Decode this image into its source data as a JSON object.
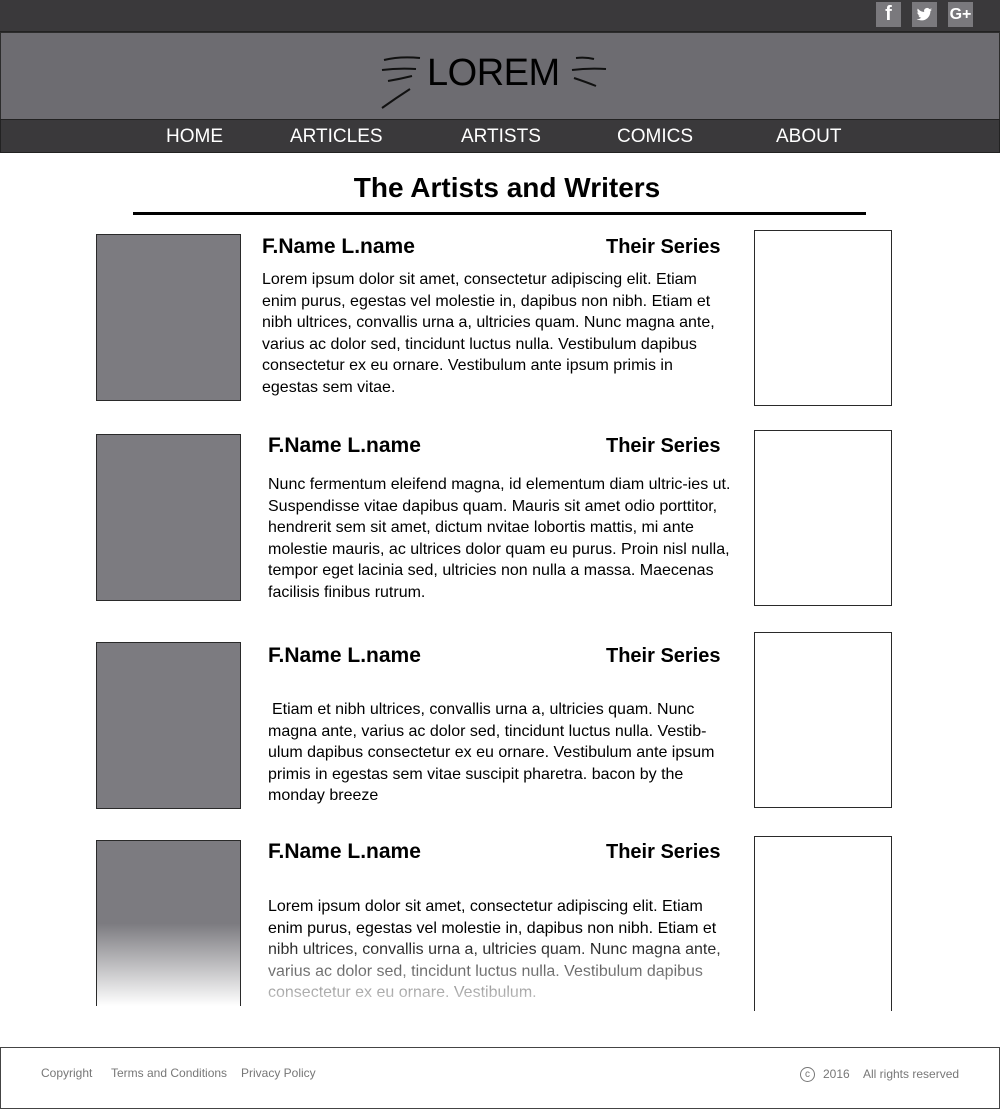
{
  "social": {
    "facebook_glyph": "f",
    "twitter_glyph": "t",
    "googleplus_glyph": "G+"
  },
  "logo": {
    "text": "LOREM"
  },
  "nav": [
    "HOME",
    "ARTICLES",
    "ARTISTS",
    "COMICS",
    "ABOUT"
  ],
  "page_title": "The Artists and Writers",
  "entries": [
    {
      "name": "F.Name L.name",
      "series": "Their Series",
      "bio": "Lorem ipsum dolor sit amet, consectetur adipiscing elit. Etiam enim purus, egestas vel molestie in, dapibus non nibh. Etiam et nibh ultrices, convallis urna a, ultricies quam. Nunc magna ante, varius ac dolor sed, tincidunt luctus nulla. Vestibulum dapibus consectetur ex eu ornare. Vestibulum ante ipsum primis in egestas sem vitae."
    },
    {
      "name": "F.Name L.name",
      "series": "Their Series",
      "bio": "Nunc fermentum eleifend magna, id elementum diam ultric-ies ut. Suspendisse vitae dapibus quam. Mauris sit amet odio porttitor, hendrerit sem sit amet, dictum nvitae lobortis mattis, mi ante molestie mauris, ac ultrices dolor quam eu purus. Proin nisl nulla, tempor eget lacinia sed, ultricies non nulla a massa. Maecenas facilisis finibus rutrum."
    },
    {
      "name": "F.Name L.name",
      "series": "Their Series",
      "bio": "Etiam et nibh ultrices, convallis urna a, ultricies quam. Nunc magna ante, varius ac dolor sed, tincidunt luctus nulla. Vestib-ulum dapibus consectetur ex eu ornare. Vestibulum ante ipsum primis in egestas sem vitae suscipit pharetra. bacon by the monday breeze"
    },
    {
      "name": "F.Name L.name",
      "series": "Their Series",
      "bio": "Lorem ipsum dolor sit amet, consectetur adipiscing elit. Etiam enim purus, egestas vel molestie in, dapibus non nibh. Etiam et nibh ultrices, convallis urna a, ultricies quam. Nunc magna ante, varius ac dolor sed, tincidunt luctus nulla. Vestibulum dapibus consectetur ex eu ornare. Vestibulum."
    }
  ],
  "footer": {
    "links": [
      "Copyright",
      "Terms and Conditions",
      "Privacy Policy"
    ],
    "year": "2016",
    "rights": "All rights reserved"
  },
  "colors": {
    "topbar": "#3a393b",
    "header": "#6d6c71",
    "photo_placeholder": "#7c7b80"
  }
}
